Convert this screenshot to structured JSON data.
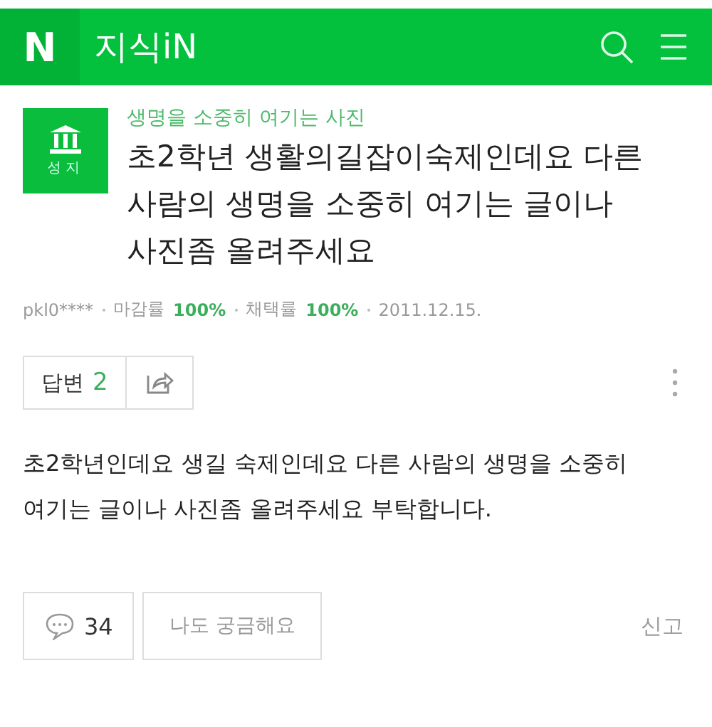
{
  "header": {
    "logo": "N",
    "title": "지식iN"
  },
  "question": {
    "badge": "성지",
    "category": "생명을 소중히 여기는 사진",
    "title": "초2학년 생활의길잡이숙제인데요 다른 사람의 생명을 소중히 여기는 글이나 사진좀 올려주세요",
    "meta": [
      {
        "kind": "user",
        "text": "pkl0****"
      },
      {
        "kind": "stat",
        "label": "마감률",
        "value": "100%"
      },
      {
        "kind": "stat",
        "label": "채택률",
        "value": "100%"
      },
      {
        "kind": "date",
        "text": "2011.12.15."
      }
    ],
    "answers": {
      "label": "답변",
      "count": "2"
    },
    "body": "초2학년인데요 생길 숙제인데요 다른 사람의 생명을 소중히 여기는 글이나 사진좀 올려주세요 부탁합니다.",
    "comments": "34",
    "curious": "나도 궁금해요",
    "report": "신고"
  }
}
